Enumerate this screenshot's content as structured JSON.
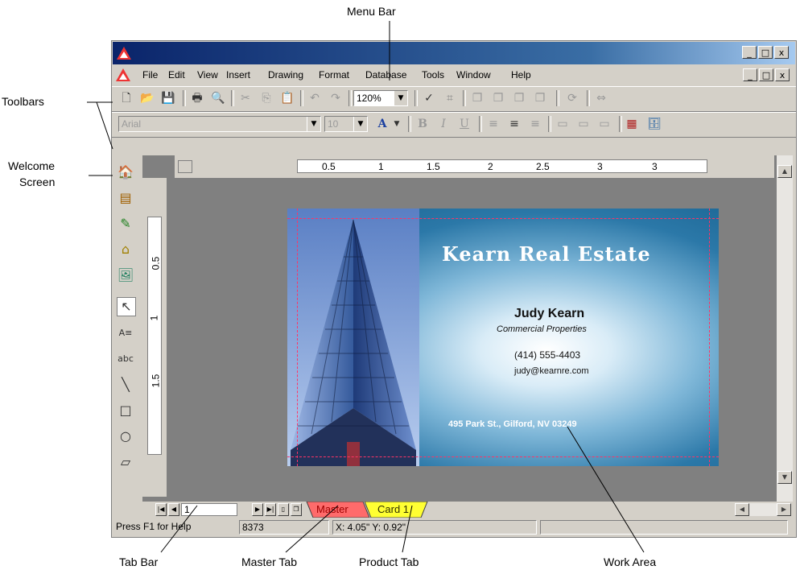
{
  "callouts": {
    "menu_bar": "Menu Bar",
    "toolbars": "Toolbars",
    "welcome_screen_line1": "Welcome",
    "welcome_screen_line2": "Screen",
    "tab_bar": "Tab Bar",
    "master_tab": "Master Tab",
    "product_tab": "Product Tab",
    "work_area": "Work Area"
  },
  "window_buttons": {
    "minimize": "_",
    "restore": "□",
    "close": "x"
  },
  "menu": [
    "File",
    "Edit",
    "View",
    "Insert",
    "Drawing",
    "Format",
    "Database",
    "Tools",
    "Window",
    "Help"
  ],
  "toolbar": {
    "zoom": "120%",
    "font": "Arial",
    "font_size": "10",
    "font_color_glyph": "A",
    "bold": "B",
    "italic": "I",
    "underline": "U"
  },
  "ruler": {
    "horizontal": [
      "0.5",
      "1",
      "1.5",
      "2",
      "2.5",
      "3",
      "3"
    ],
    "vertical": [
      "0.5",
      "1",
      "1.5"
    ]
  },
  "card": {
    "company": "Kearn Real Estate",
    "name": "Judy Kearn",
    "title": "Commercial Properties",
    "phone": "(414) 555-4403",
    "email": "judy@kearnre.com",
    "address": "495 Park St., Gilford, NV 03249"
  },
  "tabs": {
    "page": "1",
    "master": "Master",
    "card": "Card 1"
  },
  "status": {
    "help": "Press F1 for Help",
    "count": "8373",
    "coords": "X: 4.05\"  Y: 0.92\""
  },
  "colors": {
    "title_bar": "#0a246a",
    "master_tab": "#ff6b6b",
    "card_tab": "#ffff33",
    "card_blue": "#1f6fa3"
  }
}
